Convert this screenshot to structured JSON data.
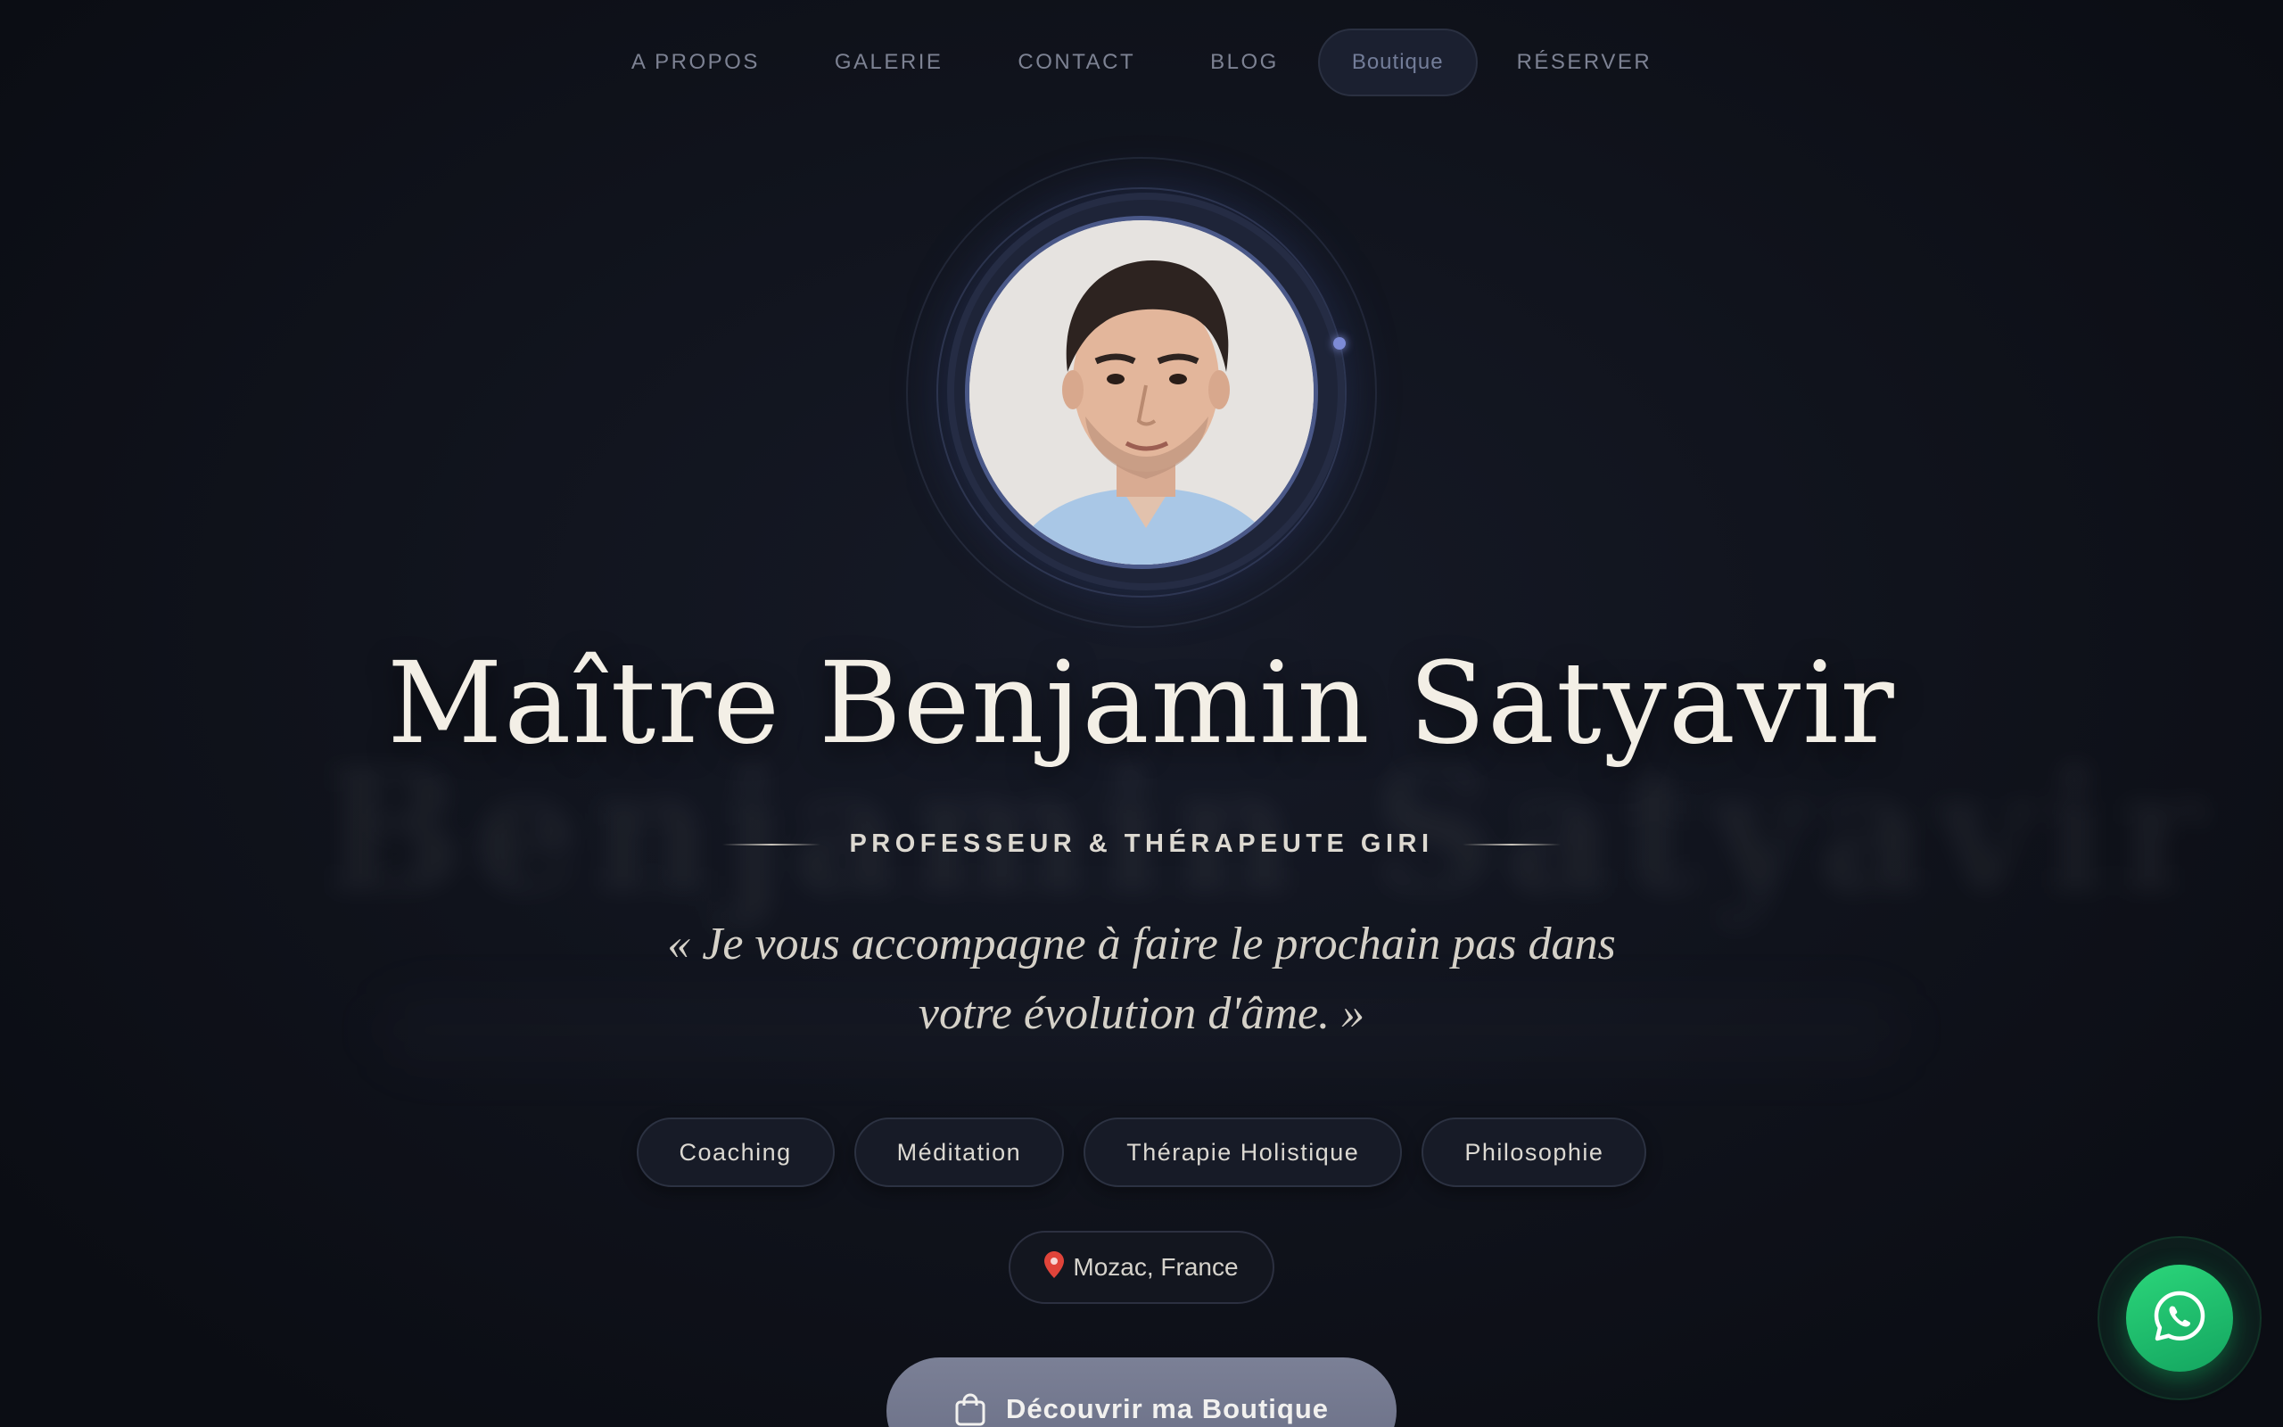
{
  "nav": {
    "items": [
      {
        "label": "A PROPOS"
      },
      {
        "label": "GALERIE"
      },
      {
        "label": "CONTACT"
      },
      {
        "label": "BLOG"
      },
      {
        "label": "Boutique"
      },
      {
        "label": "RÉSERVER"
      }
    ]
  },
  "hero": {
    "name": "Maître Benjamin Satyavir",
    "subtitle": "PROFESSEUR & THÉRAPEUTE GIRI",
    "quote_line1": "« Je vous accompagne à faire le prochain pas dans",
    "quote_line2": "votre évolution d'âme. »",
    "tags": [
      "Coaching",
      "Méditation",
      "Thérapie Holistique",
      "Philosophie"
    ],
    "location": "Mozac, France",
    "cta_label": "Découvrir ma Boutique"
  },
  "icons": {
    "location": "pin-icon",
    "cta": "shopping-bag-icon",
    "chat": "whatsapp-icon"
  },
  "colors": {
    "background": "#0e1018",
    "title": "#f3efe6",
    "cta": "#737891",
    "whatsapp": "#25d366",
    "ring_accent": "#7d8bd6"
  }
}
